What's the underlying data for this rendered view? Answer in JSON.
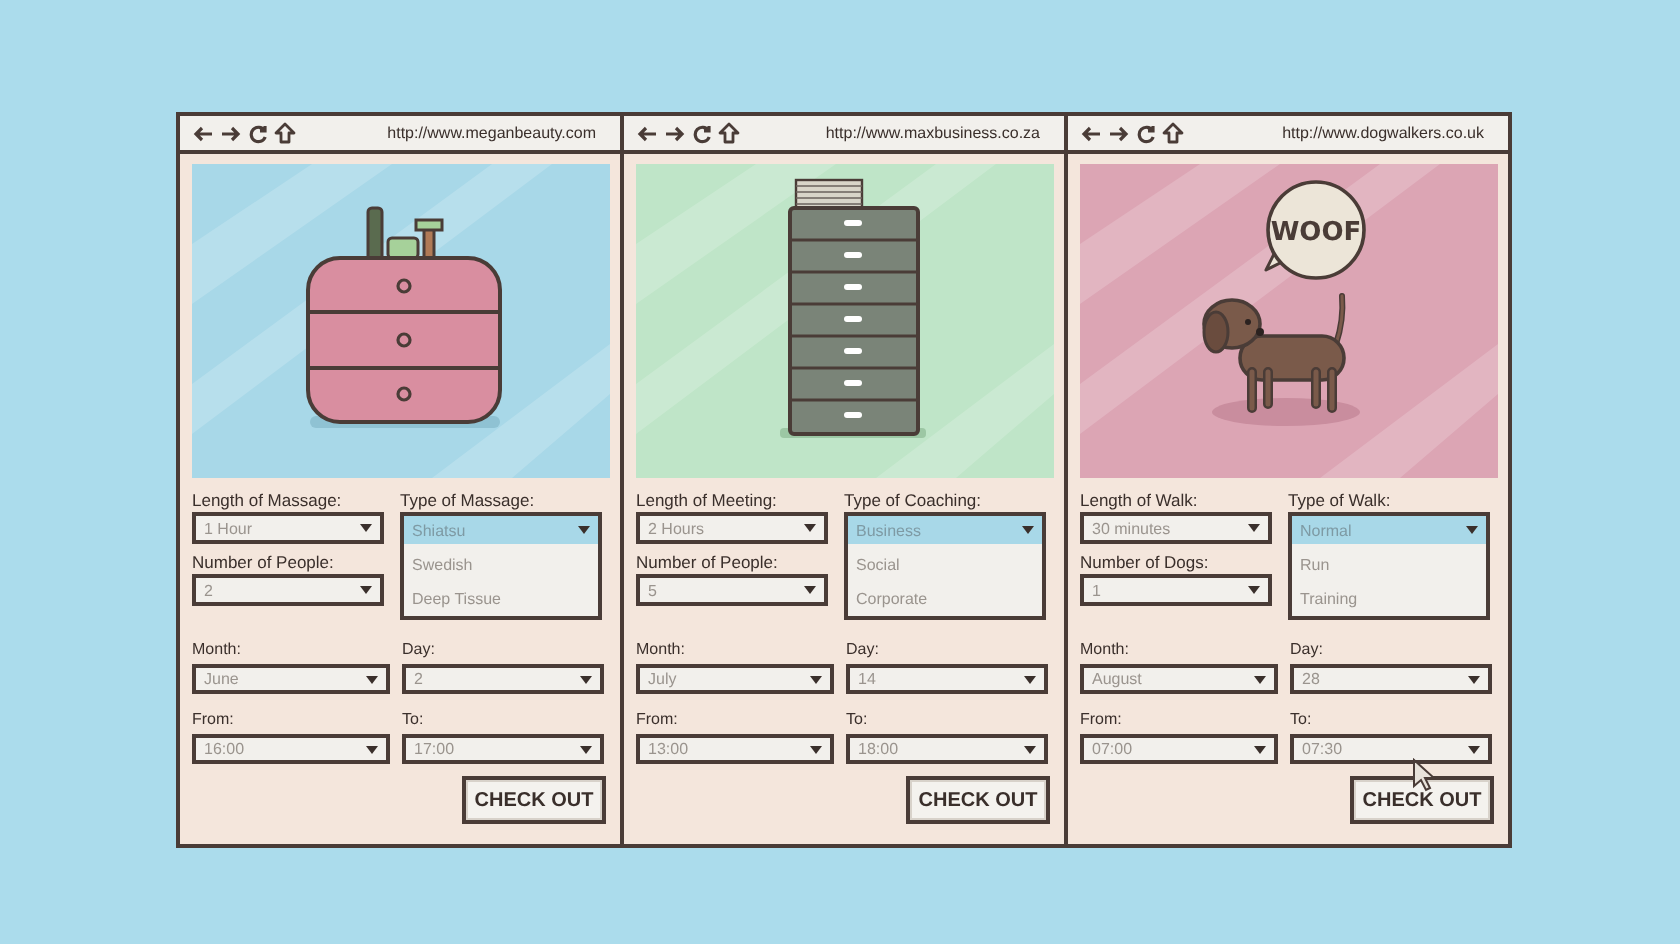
{
  "windows": [
    {
      "url": "http://www.meganbeauty.com",
      "illustration": {
        "kind": "dresser",
        "color": "#a8d8e8"
      },
      "fields": [
        {
          "label": "Length of Massage:",
          "value": "1 Hour"
        },
        {
          "label": "Number of People:",
          "value": "2"
        }
      ],
      "dropdown": {
        "label": "Type of Massage:",
        "options": [
          {
            "label": "Shiatsu",
            "selected": true
          },
          {
            "label": "Swedish",
            "selected": false
          },
          {
            "label": "Deep Tissue",
            "selected": false
          }
        ]
      },
      "date_fields": [
        {
          "label": "Month:",
          "value": "June"
        },
        {
          "label": "Day:",
          "value": "2"
        },
        {
          "label": "From:",
          "value": "16:00"
        },
        {
          "label": "To:",
          "value": "17:00"
        }
      ],
      "button": "CHECK OUT"
    },
    {
      "url": "http://www.maxbusiness.co.za",
      "illustration": {
        "kind": "cabinet",
        "color": "#bfe5c8"
      },
      "fields": [
        {
          "label": "Length of Meeting:",
          "value": "2 Hours"
        },
        {
          "label": "Number of People:",
          "value": "5"
        }
      ],
      "dropdown": {
        "label": "Type of Coaching:",
        "options": [
          {
            "label": "Business",
            "selected": true
          },
          {
            "label": "Social",
            "selected": false
          },
          {
            "label": "Corporate",
            "selected": false
          }
        ]
      },
      "date_fields": [
        {
          "label": "Month:",
          "value": "July"
        },
        {
          "label": "Day:",
          "value": "14"
        },
        {
          "label": "From:",
          "value": "13:00"
        },
        {
          "label": "To:",
          "value": "18:00"
        }
      ],
      "button": "CHECK OUT"
    },
    {
      "url": "http://www.dogwalkers.co.uk",
      "illustration": {
        "kind": "dog",
        "color": "#dca5b4",
        "speech": "WOOF"
      },
      "fields": [
        {
          "label": "Length of Walk:",
          "value": "30 minutes"
        },
        {
          "label": "Number of Dogs:",
          "value": "1"
        }
      ],
      "dropdown": {
        "label": "Type of Walk:",
        "options": [
          {
            "label": "Normal",
            "selected": true
          },
          {
            "label": "Run",
            "selected": false
          },
          {
            "label": "Training",
            "selected": false
          }
        ]
      },
      "date_fields": [
        {
          "label": "Month:",
          "value": "August"
        },
        {
          "label": "Day:",
          "value": "28"
        },
        {
          "label": "From:",
          "value": "07:00"
        },
        {
          "label": "To:",
          "value": "07:30"
        }
      ],
      "button": "CHECK OUT"
    }
  ]
}
